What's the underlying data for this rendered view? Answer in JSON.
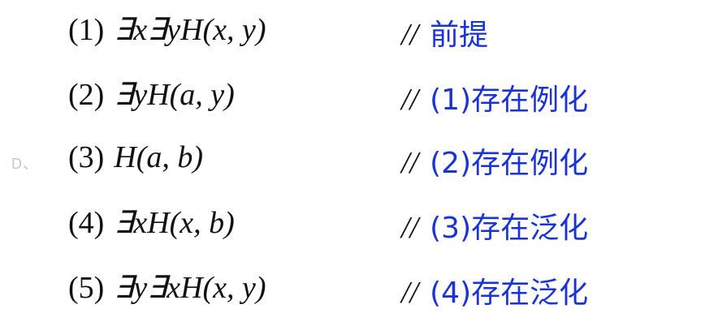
{
  "option_label": "D、",
  "proof": {
    "steps": [
      {
        "num": "(1)",
        "formula": "∃x∃yH(x, y)",
        "slashes": "//",
        "justification": "前提"
      },
      {
        "num": "(2)",
        "formula": "∃yH(a, y)",
        "slashes": "//",
        "justification": "(1)存在例化"
      },
      {
        "num": "(3)",
        "formula": "H(a, b)",
        "slashes": "//",
        "justification": "(2)存在例化"
      },
      {
        "num": "(4)",
        "formula": "∃xH(x, b)",
        "slashes": "//",
        "justification": "(3)存在泛化"
      },
      {
        "num": "(5)",
        "formula": "∃y∃xH(x, y)",
        "slashes": "//",
        "justification": "(4)存在泛化"
      }
    ]
  },
  "colors": {
    "text": "#111111",
    "justification": "#1a33d6",
    "label": "#c7c7c7"
  }
}
